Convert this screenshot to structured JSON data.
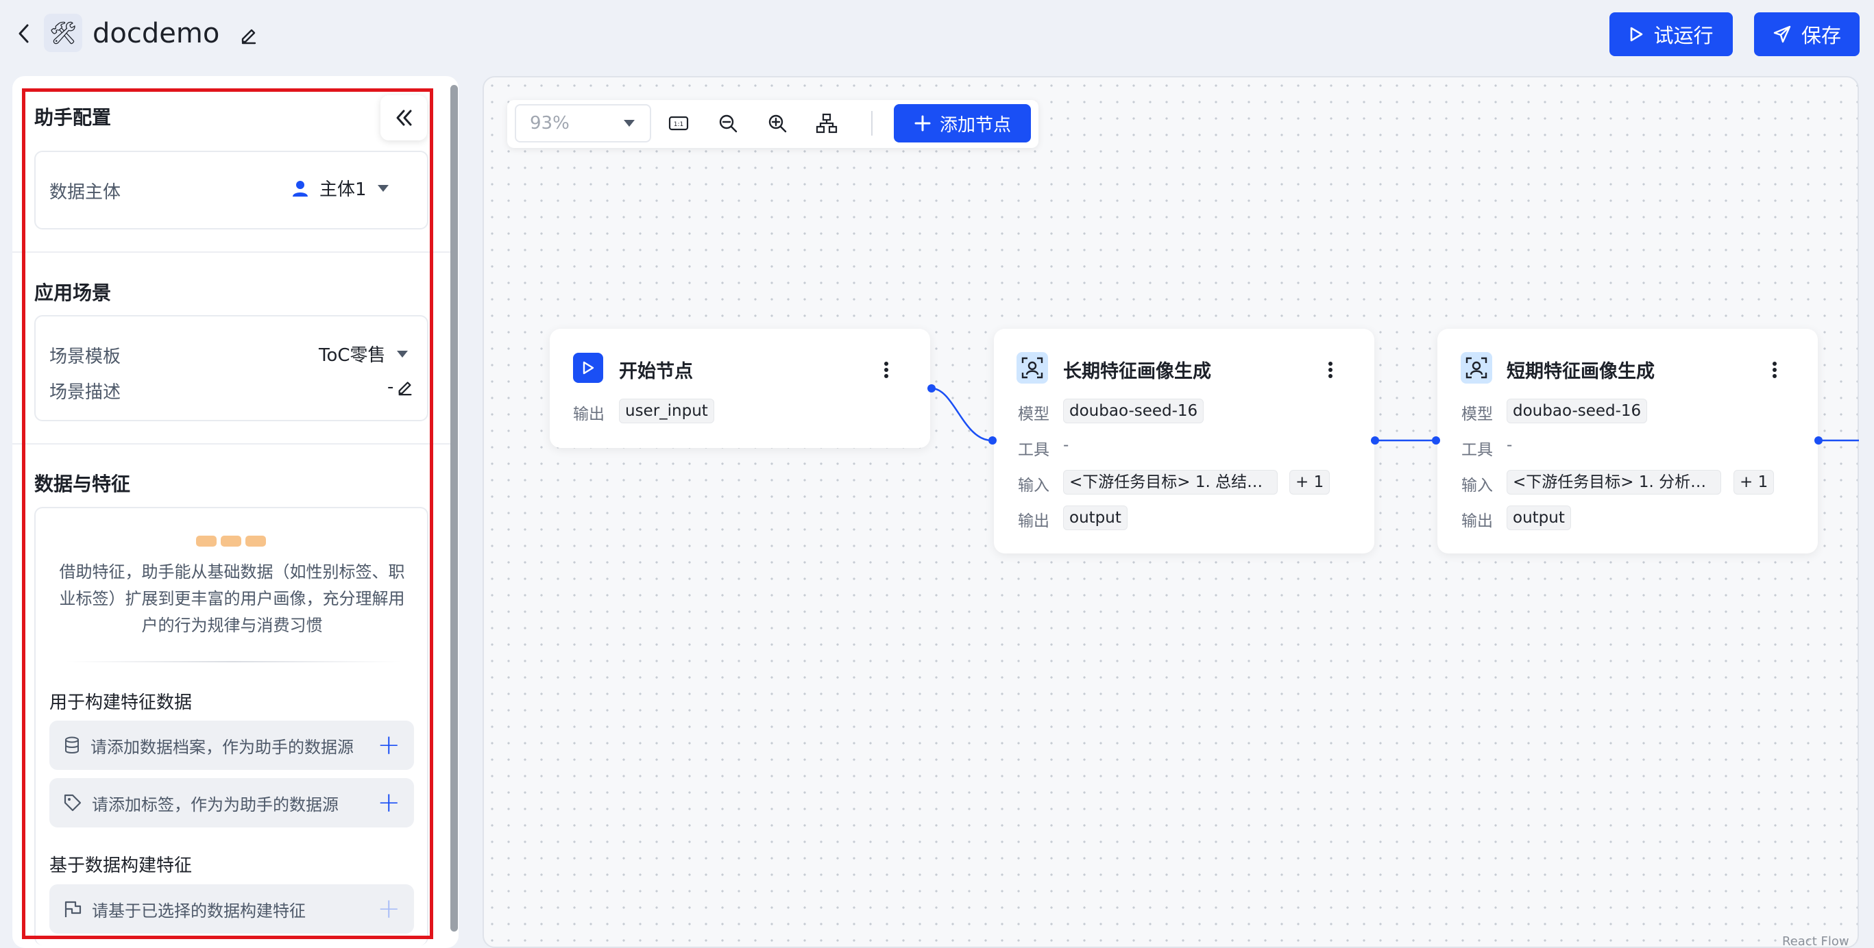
{
  "header": {
    "title": "docdemo",
    "app_icon": "🛠",
    "trial_run_label": "试运行",
    "save_label": "保存"
  },
  "sidebar": {
    "assistant_config": {
      "title": "助手配置",
      "data_subject_label": "数据主体",
      "data_subject_value": "主体1"
    },
    "scenario": {
      "title": "应用场景",
      "template_label": "场景模板",
      "template_value": "ToC零售",
      "description_label": "场景描述",
      "description_value": "-"
    },
    "data_features": {
      "title": "数据与特征",
      "intro": "借助特征，助手能从基础数据（如性别标签、职业标签）扩展到更丰富的用户画像，充分理解用户的行为规律与消费习惯",
      "build_data_title": "用于构建特征数据",
      "add_archive_placeholder": "请添加数据档案，作为助手的数据源",
      "add_tag_placeholder": "请添加标签，作为为助手的数据源",
      "build_features_title": "基于数据构建特征",
      "build_features_placeholder": "请基于已选择的数据构建特征"
    }
  },
  "canvas": {
    "zoom": "93%",
    "add_node_label": "添加节点",
    "watermark": "React Flow",
    "nodes": [
      {
        "title": "开始节点",
        "output_label": "输出",
        "output_value": "user_input"
      },
      {
        "title": "长期特征画像生成",
        "model_label": "模型",
        "model_value": "doubao-seed-16",
        "tool_label": "工具",
        "tool_value": "-",
        "input_label": "输入",
        "input_value": "<下游任务目标> 1. 总结用…",
        "input_extra": "+ 1",
        "output_label": "输出",
        "output_value": "output"
      },
      {
        "title": "短期特征画像生成",
        "model_label": "模型",
        "model_value": "doubao-seed-16",
        "tool_label": "工具",
        "tool_value": "-",
        "input_label": "输入",
        "input_value": "<下游任务目标> 1. 分析用…",
        "input_extra": "+ 1",
        "output_label": "输出",
        "output_value": "output"
      }
    ]
  },
  "colors": {
    "primary": "#1a4ff5",
    "highlight": "#e1141b"
  }
}
